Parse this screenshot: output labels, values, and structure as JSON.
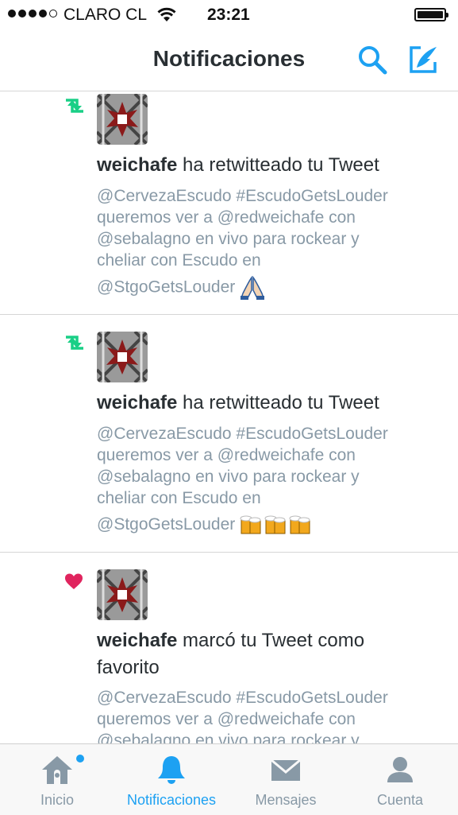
{
  "status_bar": {
    "carrier": "CLARO CL",
    "time": "23:21"
  },
  "header": {
    "title": "Notificaciones"
  },
  "notifications": [
    {
      "type": "retweet",
      "user": "weichafe",
      "action": " ha retwitteado tu Tweet",
      "tweet_lines": [
        "@CervezaEscudo #EscudoGetsLouder",
        "queremos ver a @redweichafe con",
        "@sebalagno en vivo para rockear y",
        "cheliar con Escudo en",
        "@StgoGetsLouder"
      ],
      "emoji": "folded-hands"
    },
    {
      "type": "retweet",
      "user": "weichafe",
      "action": " ha retwitteado tu Tweet",
      "tweet_lines": [
        "@CervezaEscudo #EscudoGetsLouder",
        "queremos ver a @redweichafe con",
        "@sebalagno en vivo para rockear y",
        "cheliar con Escudo en",
        "@StgoGetsLouder"
      ],
      "emoji": "beer-mugs"
    },
    {
      "type": "favorite",
      "user": "weichafe",
      "action": " marcó tu Tweet como favorito",
      "tweet_lines": [
        "@CervezaEscudo #EscudoGetsLouder",
        "queremos ver a @redweichafe con",
        "@sebalagno en vivo para rockear y"
      ]
    }
  ],
  "tabs": [
    {
      "label": "Inicio",
      "icon": "home-icon",
      "active": false,
      "unread": true
    },
    {
      "label": "Notificaciones",
      "icon": "bell-icon",
      "active": true
    },
    {
      "label": "Mensajes",
      "icon": "envelope-icon",
      "active": false
    },
    {
      "label": "Cuenta",
      "icon": "person-icon",
      "active": false
    }
  ],
  "colors": {
    "accent": "#1da1f2",
    "retweet": "#19cf86",
    "heart": "#e0245e",
    "muted": "#8899a6",
    "text": "#292f33"
  }
}
